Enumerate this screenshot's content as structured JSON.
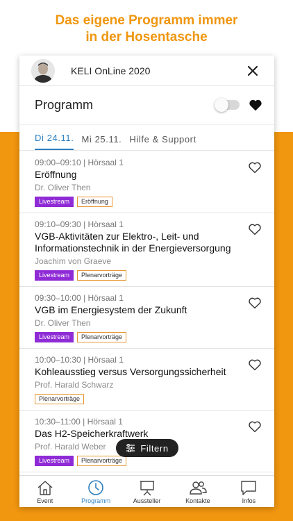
{
  "tagline": {
    "line1": "Das eigene Programm immer",
    "line2": "in der Hosentasche"
  },
  "header": {
    "title": "KELI OnLine 2020"
  },
  "programm": {
    "title": "Programm"
  },
  "tabs": [
    {
      "label": "Di 24.11.",
      "active": true
    },
    {
      "label": "Mi 25.11.",
      "active": false
    },
    {
      "label": "Hilfe & Support",
      "active": false
    }
  ],
  "items": [
    {
      "time": "09:00–09:10 | Hörsaal 1",
      "title": "Eröffnung",
      "speaker": "Dr. Oliver Then",
      "tags": [
        "Livestream",
        "Eröffnung"
      ]
    },
    {
      "time": "09:10–09:30 | Hörsaal 1",
      "title": "VGB-Aktivitäten zur Elektro-, Leit- und Informationstechnik in der Energieversorgung",
      "speaker": "Joachim von Graeve",
      "tags": [
        "Livestream",
        "Plenarvorträge"
      ]
    },
    {
      "time": "09:30–10:00 | Hörsaal 1",
      "title": "VGB im Energiesystem der Zukunft",
      "speaker": "Dr. Oliver Then",
      "tags": [
        "Livestream",
        "Plenarvorträge"
      ]
    },
    {
      "time": "10:00–10:30 | Hörsaal 1",
      "title": "Kohleausstieg versus Versorgungssicherheit",
      "speaker": "Prof. Harald Schwarz",
      "tags": [
        "Plenarvorträge"
      ]
    },
    {
      "time": "10:30–11:00 | Hörsaal 1",
      "title": "Das H2-Speicherkraftwerk",
      "speaker": "Prof. Harald Weber",
      "tags": [
        "Livestream",
        "Plenarvorträge"
      ]
    }
  ],
  "filter": {
    "label": "Filtern"
  },
  "nav": [
    {
      "label": "Event",
      "icon": "house-icon",
      "active": false
    },
    {
      "label": "Programm",
      "icon": "clock-icon",
      "active": true
    },
    {
      "label": "Aussteller",
      "icon": "presentation-board-icon",
      "active": false
    },
    {
      "label": "Kontakte",
      "icon": "people-icon",
      "active": false
    },
    {
      "label": "Infos",
      "icon": "chat-bubble-icon",
      "active": false
    }
  ],
  "colors": {
    "accent_orange": "#f0960f",
    "active_blue": "#2a7ec0",
    "livestream_purple": "#8f2bd6"
  }
}
